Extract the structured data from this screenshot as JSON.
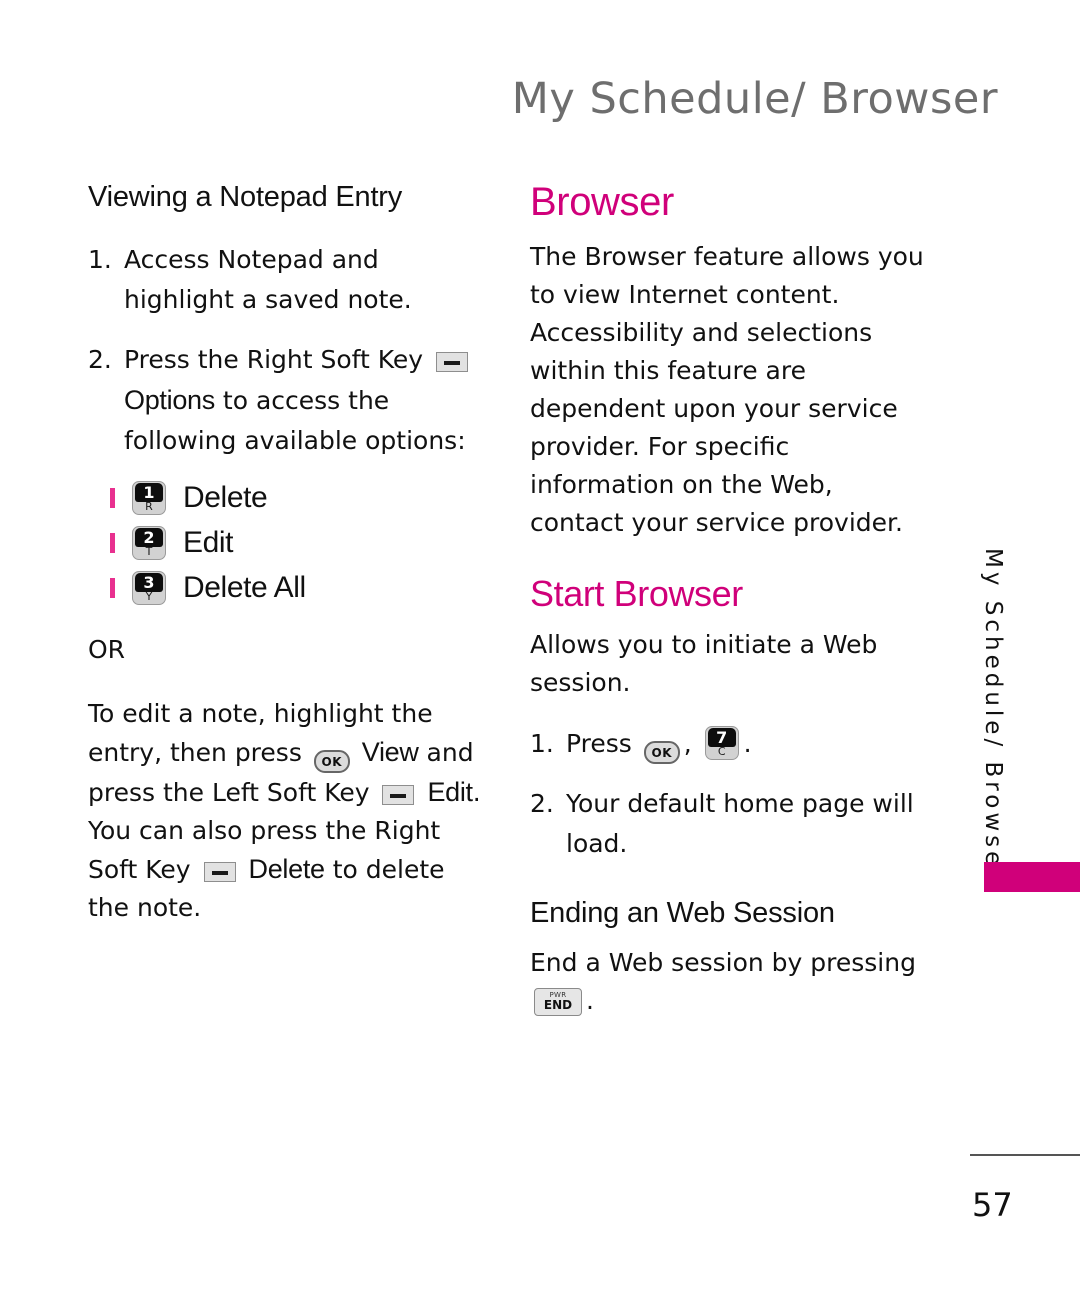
{
  "colors": {
    "accent_pink": "#d0007a",
    "bullet_pink": "#e8308f",
    "header_gray": "#6e6e6e",
    "body_black": "#111111"
  },
  "header": {
    "running_title": "My Schedule/ Browser"
  },
  "side_tab": {
    "label": "My Schedule/ Browser"
  },
  "footer": {
    "page_number": "57"
  },
  "left_column": {
    "heading": "Viewing a Notepad Entry",
    "step1": {
      "number": "1.",
      "text": "Access Notepad and highlight a saved note."
    },
    "step2": {
      "number": "2.",
      "text_before_key": "Press the Right Soft Key",
      "key_icon": "right-soft-key-icon",
      "emph": "Options",
      "text_after_emph": "to access the following available options:"
    },
    "options": [
      {
        "key_number": "1",
        "key_letter": "R",
        "label": "Delete"
      },
      {
        "key_number": "2",
        "key_letter": "T",
        "label": "Edit"
      },
      {
        "key_number": "3",
        "key_letter": "Y",
        "label": "Delete All"
      }
    ],
    "or_label": "OR",
    "alt_paragraph": {
      "part1": "To edit a note, highlight the entry, then press",
      "ok_icon_label": "OK",
      "emph1": "View",
      "part2": "and press the Left Soft Key",
      "softkey1_icon": "left-soft-key-icon",
      "emph2": "Edit",
      "part3": ". You can also press the Right Soft Key",
      "softkey2_icon": "right-soft-key-icon",
      "emph3": "Delete",
      "part4": "to delete the note."
    }
  },
  "right_column": {
    "heading": "Browser",
    "intro": "The Browser feature allows you to view Internet content. Accessibility and selections within this feature are dependent upon your service provider. For specific information on the Web, contact your service provider.",
    "start_browser": {
      "heading": "Start Browser",
      "description": "Allows you to initiate a Web session.",
      "step1": {
        "number": "1.",
        "text": "Press",
        "ok_icon_label": "OK",
        "comma": ",",
        "key_number": "7",
        "key_letter": "C",
        "period": "."
      },
      "step2": {
        "number": "2.",
        "text": "Your default home page will load."
      }
    },
    "ending_session": {
      "heading": "Ending an Web Session",
      "text": "End a Web session by pressing",
      "end_key": {
        "pwr": "PWR",
        "end": "END"
      },
      "period": "."
    }
  }
}
